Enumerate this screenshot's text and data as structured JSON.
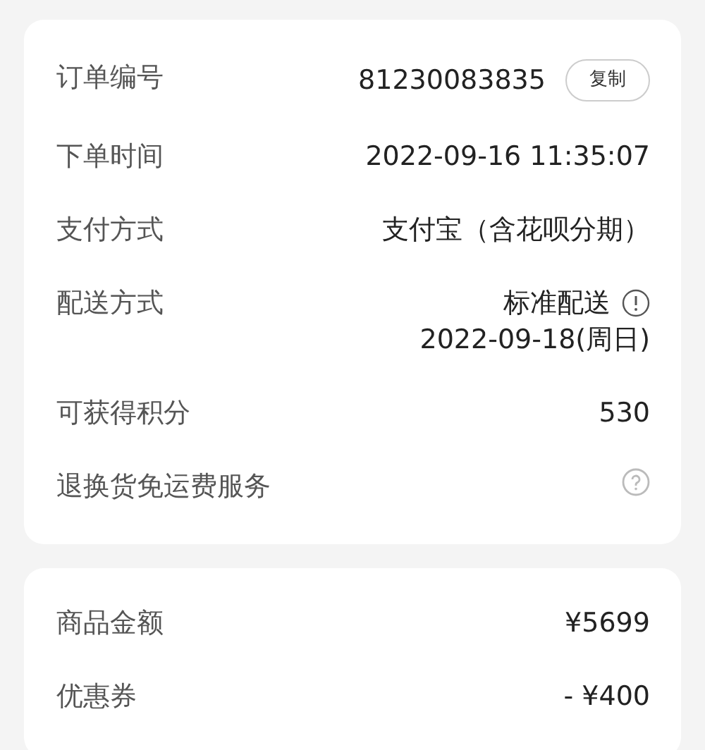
{
  "order_info": [
    {
      "kind": "copy",
      "label": "订单编号",
      "value": "81230083835",
      "button": "复制"
    },
    {
      "kind": "plain",
      "label": "下单时间",
      "value": "2022-09-16 11:35:07"
    },
    {
      "kind": "plain",
      "label": "支付方式",
      "value": "支付宝（含花呗分期）"
    },
    {
      "kind": "info",
      "label": "配送方式",
      "value": "标准配送",
      "sub": "2022-09-18(周日)"
    },
    {
      "kind": "plain",
      "label": "可获得积分",
      "value": "530"
    },
    {
      "kind": "help",
      "label": "退换货免运费服务"
    }
  ],
  "price_info": [
    {
      "kind": "plain",
      "label": "商品金额",
      "value": "¥5699"
    },
    {
      "kind": "plain",
      "label": "优惠券",
      "value": "- ¥400"
    }
  ]
}
